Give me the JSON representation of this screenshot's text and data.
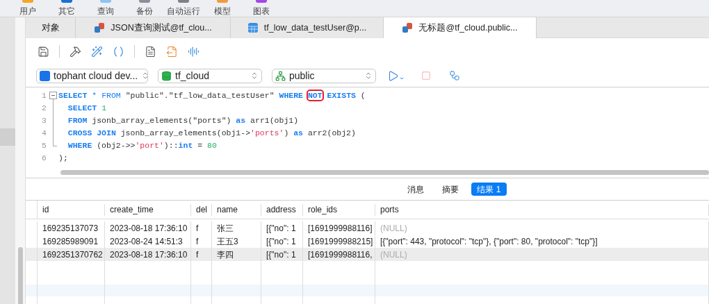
{
  "top_toolbar": [
    {
      "label": "用户",
      "color": "#f5a623"
    },
    {
      "label": "其它",
      "color": "#1a6fd1"
    },
    {
      "label": "查询",
      "color": "#8cc4f5"
    },
    {
      "label": "备份",
      "color": "#8a8f99"
    },
    {
      "label": "自动运行",
      "color": "#7d8088"
    },
    {
      "label": "模型",
      "color": "#f59a3c"
    },
    {
      "label": "图表",
      "color": "#a546e8"
    }
  ],
  "tabs": [
    {
      "label": "对象",
      "kind": "objects",
      "selected": false
    },
    {
      "label": "JSON查询测试@tf_clou...",
      "kind": "query",
      "selected": false
    },
    {
      "label": "tf_low_data_testUser@p...",
      "kind": "table",
      "selected": false
    },
    {
      "label": "无标题@tf_cloud.public...",
      "kind": "query",
      "selected": true
    }
  ],
  "selectors": [
    {
      "value": "tophant cloud dev...",
      "kind": "connection"
    },
    {
      "value": "tf_cloud",
      "kind": "database"
    },
    {
      "value": "public",
      "kind": "schema"
    }
  ],
  "editor": {
    "lines": [
      {
        "number": "1",
        "tokens": [
          {
            "text": "SELECT",
            "kind": "keyword"
          },
          {
            "text": " * FROM ",
            "kind": "mixed"
          },
          {
            "text": "\"public\".\"tf_low_data_testUser\" ",
            "kind": "plain"
          },
          {
            "text": "WHERE ",
            "kind": "keyword"
          },
          {
            "text": "NOT",
            "kind": "keyword",
            "highlighted": true
          },
          {
            "text": " EXISTS",
            "kind": "keyword"
          },
          {
            "text": " (",
            "kind": "plain"
          }
        ]
      },
      {
        "number": "2",
        "tokens": [
          {
            "text": "  SELECT ",
            "kind": "keyword"
          },
          {
            "text": "1",
            "kind": "number"
          }
        ]
      },
      {
        "number": "3",
        "tokens": [
          {
            "text": "  FROM ",
            "kind": "keyword"
          },
          {
            "text": "jsonb_array_elements(\"ports\") ",
            "kind": "plain"
          },
          {
            "text": "as",
            "kind": "keyword"
          },
          {
            "text": " arr1(obj1)",
            "kind": "plain"
          }
        ]
      },
      {
        "number": "4",
        "tokens": [
          {
            "text": "  CROSS JOIN ",
            "kind": "keyword"
          },
          {
            "text": "jsonb_array_elements(obj1->",
            "kind": "plain"
          },
          {
            "text": "'ports'",
            "kind": "string"
          },
          {
            "text": ") ",
            "kind": "plain"
          },
          {
            "text": "as",
            "kind": "keyword"
          },
          {
            "text": " arr2(obj2)",
            "kind": "plain"
          }
        ]
      },
      {
        "number": "5",
        "tokens": [
          {
            "text": "  WHERE ",
            "kind": "keyword"
          },
          {
            "text": "(obj2->>",
            "kind": "plain"
          },
          {
            "text": "'port'",
            "kind": "string"
          },
          {
            "text": ")::",
            "kind": "plain"
          },
          {
            "text": "int",
            "kind": "keyword"
          },
          {
            "text": " = ",
            "kind": "plain"
          },
          {
            "text": "80",
            "kind": "number"
          }
        ]
      },
      {
        "number": "6",
        "tokens": [
          {
            "text": ");",
            "kind": "plain"
          }
        ]
      }
    ]
  },
  "result_tabs": [
    {
      "label": "消息",
      "selected": false
    },
    {
      "label": "摘要",
      "selected": false
    },
    {
      "label": "结果 1",
      "selected": true
    }
  ],
  "table": {
    "columns": [
      "id",
      "create_time",
      "del",
      "name",
      "address",
      "role_ids",
      "ports"
    ],
    "rows": [
      {
        "highlighted": false,
        "cells": [
          {
            "text": "169235137073",
            "kind": "value"
          },
          {
            "text": "2023-08-18 17:36:10",
            "kind": "value"
          },
          {
            "text": "f",
            "kind": "value"
          },
          {
            "text": "张三",
            "kind": "value"
          },
          {
            "text": "[{\"no\": 1",
            "kind": "value"
          },
          {
            "text": "[1691999988116]",
            "kind": "value"
          },
          {
            "text": "(NULL)",
            "kind": "null"
          }
        ]
      },
      {
        "highlighted": false,
        "cells": [
          {
            "text": "169285989091",
            "kind": "value"
          },
          {
            "text": "2023-08-24 14:51:3",
            "kind": "value"
          },
          {
            "text": "f",
            "kind": "value"
          },
          {
            "text": "王五3",
            "kind": "value"
          },
          {
            "text": "[{\"no\": 1",
            "kind": "value"
          },
          {
            "text": "[1691999988215]",
            "kind": "value"
          },
          {
            "text": "[{\"port\": 443, \"protocol\": \"tcp\"}, {\"port\": 80, \"protocol\": \"tcp\"}]",
            "kind": "value"
          }
        ]
      },
      {
        "highlighted": true,
        "cells": [
          {
            "text": "1692351370762",
            "kind": "value"
          },
          {
            "text": "2023-08-18 17:36:10",
            "kind": "value"
          },
          {
            "text": "f",
            "kind": "value"
          },
          {
            "text": "李四",
            "kind": "value"
          },
          {
            "text": "[{\"no\": 1",
            "kind": "value"
          },
          {
            "text": "[1691999988116,",
            "kind": "value"
          },
          {
            "text": "(NULL)",
            "kind": "null"
          }
        ]
      }
    ]
  }
}
